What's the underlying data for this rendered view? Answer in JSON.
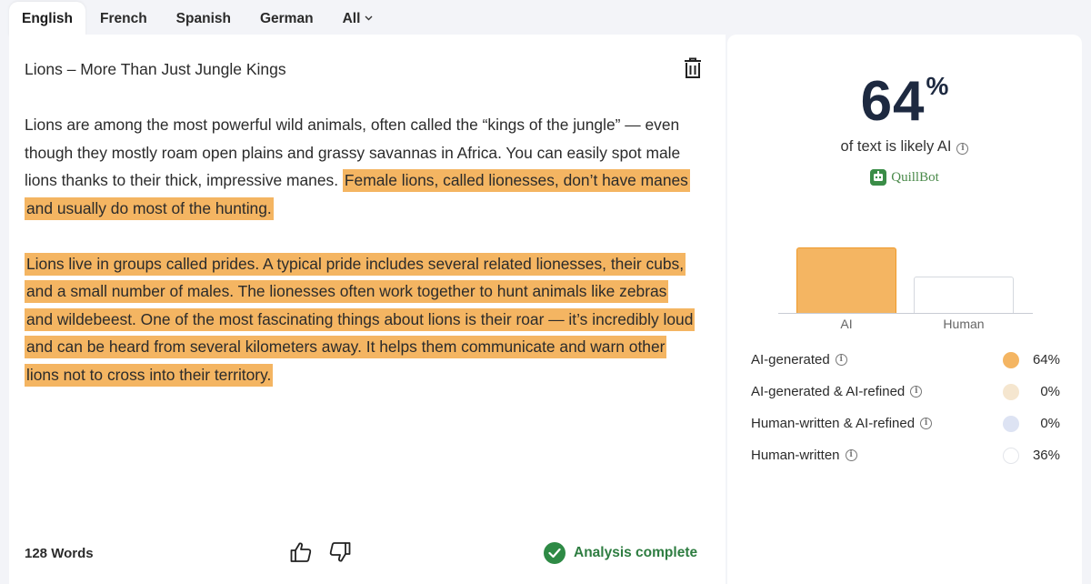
{
  "tabs": [
    {
      "label": "English",
      "active": true
    },
    {
      "label": "French"
    },
    {
      "label": "Spanish"
    },
    {
      "label": "German"
    },
    {
      "label": "All"
    }
  ],
  "editor": {
    "title": "Lions – More Than Just Jungle Kings",
    "paragraphs": [
      {
        "plain": "Lions are among the most powerful wild animals, often called the “kings of the jungle” — even though they mostly roam open plains and grassy savannas in Africa. You can easily spot male lions thanks to their thick, impressive manes.",
        "highlighted": "Female lions, called lionesses, don’t have manes and usually do most of the hunting."
      },
      {
        "plain": "",
        "highlighted": "Lions live in groups called prides. A typical pride includes several related lionesses, their cubs, and a small number of males. The lionesses often work together to hunt animals like zebras and wildebeest. One of the most fascinating things about lions is their roar — it’s incredibly loud and can be heard from several kilometers away. It helps them communicate and warn other lions not to cross into their territory."
      }
    ],
    "word_count": "128 Words",
    "status": "Analysis complete"
  },
  "results": {
    "percent_value": "64",
    "percent_symbol": "%",
    "subtitle": "of text is likely AI",
    "brand": "QuillBot",
    "chart_data": {
      "type": "bar",
      "categories": [
        "AI",
        "Human"
      ],
      "values": [
        64,
        36
      ],
      "ylim": [
        0,
        100
      ]
    },
    "legend": [
      {
        "label": "AI-generated",
        "value": "64%",
        "color": "#f4b562"
      },
      {
        "label": "AI-generated & AI-refined",
        "value": "0%",
        "color": "#f5e6cf"
      },
      {
        "label": "Human-written & AI-refined",
        "value": "0%",
        "color": "#dde3f3"
      },
      {
        "label": "Human-written",
        "value": "36%",
        "color": "#ffffff"
      }
    ]
  },
  "colors": {
    "highlight": "#f4b562",
    "accent_green": "#2e8a45",
    "heading_navy": "#1d2940"
  }
}
